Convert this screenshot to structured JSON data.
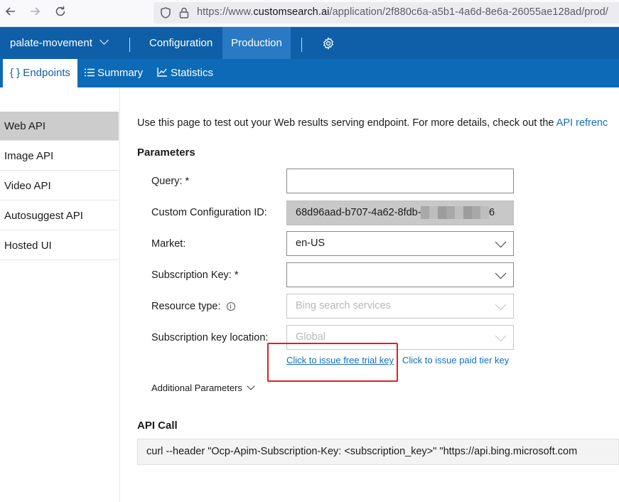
{
  "browser": {
    "url_scheme": "https://www.",
    "url_domain": "customsearch.ai",
    "url_path": "/application/2f880c6a-a5b1-4a6d-8e6a-26055ae128ad/prod/"
  },
  "top_nav": {
    "app_name": "palate-movement",
    "items": [
      {
        "label": "Configuration"
      },
      {
        "label": "Production"
      }
    ]
  },
  "sub_nav": {
    "items": [
      {
        "label": "{ } Endpoints"
      },
      {
        "label": "Summary"
      },
      {
        "label": "Statistics"
      }
    ]
  },
  "sidebar": {
    "items": [
      {
        "label": "Web API"
      },
      {
        "label": "Image API"
      },
      {
        "label": "Video API"
      },
      {
        "label": "Autosuggest API"
      },
      {
        "label": "Hosted UI"
      }
    ]
  },
  "main": {
    "intro_text": "Use this page to test out your Web results serving endpoint. For more details, check out the",
    "intro_link": "API refrenc",
    "parameters_title": "Parameters",
    "fields": {
      "query": {
        "label": "Query: *",
        "value": ""
      },
      "config_id": {
        "label": "Custom Configuration ID:",
        "value": "68d96aad-b707-4a62-8fdb-0",
        "value_suffix": "6"
      },
      "market": {
        "label": "Market:",
        "value": "en-US"
      },
      "subscription_key": {
        "label": "Subscription Key: *",
        "value": ""
      },
      "resource_type": {
        "label": "Resource type:",
        "value": "Bing search services"
      },
      "key_location": {
        "label": "Subscription key location:",
        "value": "Global"
      }
    },
    "free_trial_link": "Click to issue free trial key",
    "paid_tier_link": "Click to issue paid tier key",
    "additional_parameters": "Additional Parameters",
    "api_call_title": "API Call",
    "api_call_text": "curl --header \"Ocp-Apim-Subscription-Key: <subscription_key>\" \"https://api.bing.microsoft.com"
  },
  "colors": {
    "nav_blue": "#0f5fa8",
    "subnav_blue": "#0c6ab7",
    "link_blue": "#106ebe",
    "highlight_red": "#e0201e"
  }
}
